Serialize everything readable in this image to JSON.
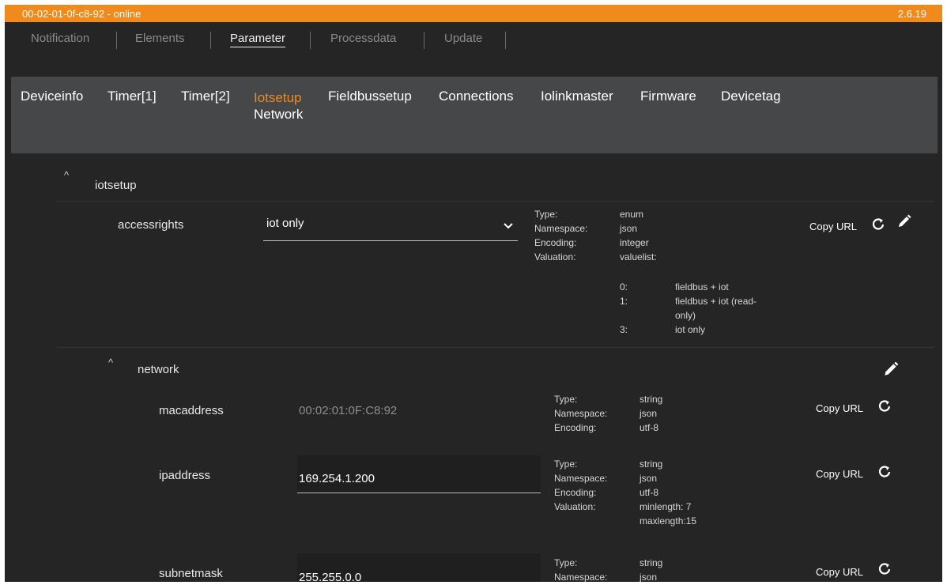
{
  "titlebar": {
    "device": "00-02-01-0f-c8-92 - online",
    "version": "2.6.19",
    "color": "#f08a1c"
  },
  "mainnav": {
    "items": [
      "Notification",
      "Elements",
      "Parameter",
      "Processdata",
      "Update"
    ],
    "active": "Parameter"
  },
  "subnav": {
    "tabs": [
      "Deviceinfo",
      "Timer[1]",
      "Timer[2]",
      "Iotsetup",
      "Fieldbussetup",
      "Connections",
      "Iolinkmaster",
      "Firmware",
      "Devicetag"
    ],
    "active": "Iotsetup",
    "active_sublabel": "Network"
  },
  "sections": {
    "iotsetup": {
      "title": "iotsetup",
      "caret": "^",
      "accessrights": {
        "label": "accessrights",
        "selected": "iot only",
        "meta": {
          "type_k": "Type:",
          "type_v": "enum",
          "ns_k": "Namespace:",
          "ns_v": "json",
          "enc_k": "Encoding:",
          "enc_v": "integer",
          "val_k": "Valuation:",
          "val_v": "valuelist:",
          "options": [
            {
              "k": "0:",
              "v": "fieldbus + iot"
            },
            {
              "k": "1:",
              "v": "fieldbus + iot (read-only)"
            },
            {
              "k": "3:",
              "v": "iot only"
            }
          ]
        },
        "copy_url": "Copy URL"
      }
    },
    "network": {
      "title": "network",
      "caret": "^",
      "macaddress": {
        "label": "macaddress",
        "value": "00:02:01:0F:C8:92",
        "meta": {
          "type_k": "Type:",
          "type_v": "string",
          "ns_k": "Namespace:",
          "ns_v": "json",
          "enc_k": "Encoding:",
          "enc_v": "utf-8"
        },
        "copy_url": "Copy URL"
      },
      "ipaddress": {
        "label": "ipaddress",
        "value": "169.254.1.200",
        "meta": {
          "type_k": "Type:",
          "type_v": "string",
          "ns_k": "Namespace:",
          "ns_v": "json",
          "enc_k": "Encoding:",
          "enc_v": "utf-8",
          "val_k": "Valuation:",
          "val_v1": "minlength: 7",
          "val_v2": "maxlength:15"
        },
        "copy_url": "Copy URL"
      },
      "subnetmask": {
        "label": "subnetmask",
        "value": "255.255.0.0",
        "meta": {
          "type_k": "Type:",
          "type_v": "string",
          "ns_k": "Namespace:",
          "ns_v": "json"
        },
        "copy_url": "Copy URL"
      }
    }
  },
  "icons": {
    "reset": "reset-icon",
    "edit": "pencil-icon",
    "dropdown": "chevron-down-icon"
  }
}
